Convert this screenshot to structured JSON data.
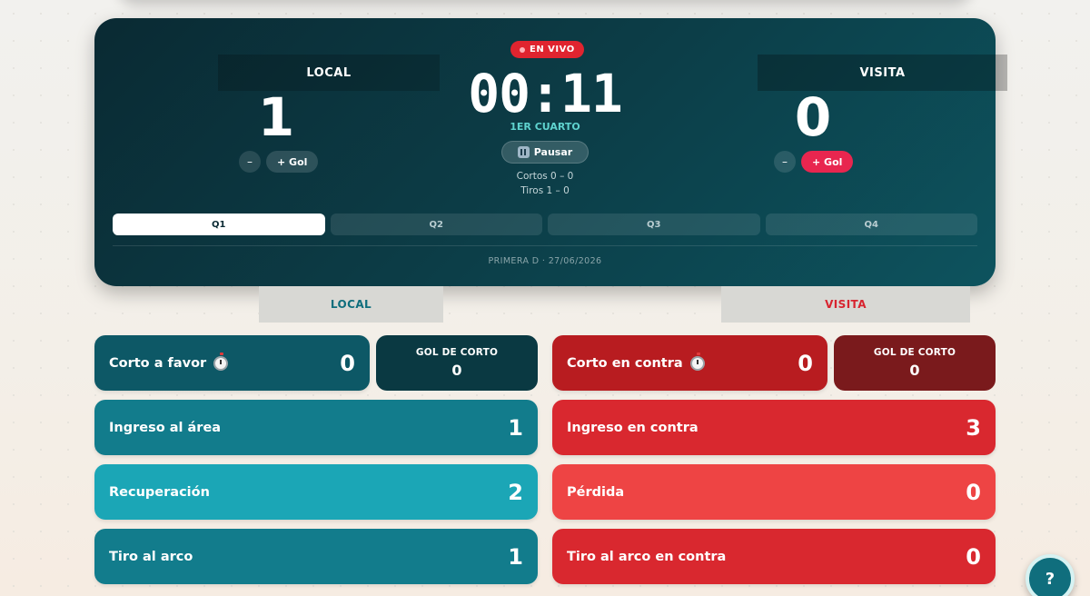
{
  "live_badge": "EN VIVO",
  "local": {
    "name": "LOCAL",
    "score": "1",
    "minus": "–",
    "add_goal": "+ Gol"
  },
  "visita": {
    "name": "VISITA",
    "score": "0",
    "minus": "–",
    "add_goal": "+ Gol"
  },
  "clock": {
    "time": "00:11",
    "quarter": "1ER CUARTO",
    "pause_label": "Pausar"
  },
  "mini_stats": {
    "cortos": "Cortos 0 – 0",
    "tiros": "Tiros 1 – 0"
  },
  "tabs": [
    "Q1",
    "Q2",
    "Q3",
    "Q4"
  ],
  "active_tab": "Q1",
  "meta": "PRIMERA D · 27/06/2026",
  "side_tabs": {
    "local": "LOCAL",
    "visita": "VISITA"
  },
  "local_stats": {
    "corto_favor": {
      "label": "Corto a favor",
      "value": "0"
    },
    "gol_corto": {
      "label": "GOL DE CORTO",
      "value": "0"
    },
    "ingreso_area": {
      "label": "Ingreso al área",
      "value": "1"
    },
    "recuperacion": {
      "label": "Recuperación",
      "value": "2"
    },
    "tiro_arco": {
      "label": "Tiro al arco",
      "value": "1"
    }
  },
  "visita_stats": {
    "corto_contra": {
      "label": "Corto en contra",
      "value": "0"
    },
    "gol_corto": {
      "label": "GOL DE CORTO",
      "value": "0"
    },
    "ingreso_contra": {
      "label": "Ingreso en contra",
      "value": "3"
    },
    "perdida": {
      "label": "Pérdida",
      "value": "0"
    },
    "tiro_contra": {
      "label": "Tiro al arco en contra",
      "value": "0"
    }
  },
  "help_label": "?",
  "colors": {
    "local_dark": "#0d5866",
    "local_mid": "#127c8c",
    "local_light": "#1ba6b6",
    "visita_red": "#d9282f",
    "visita_light": "#ee4444",
    "visita_dark": "#7a1a1c",
    "live": "#e0242f",
    "goal_button": "#e8264f"
  }
}
